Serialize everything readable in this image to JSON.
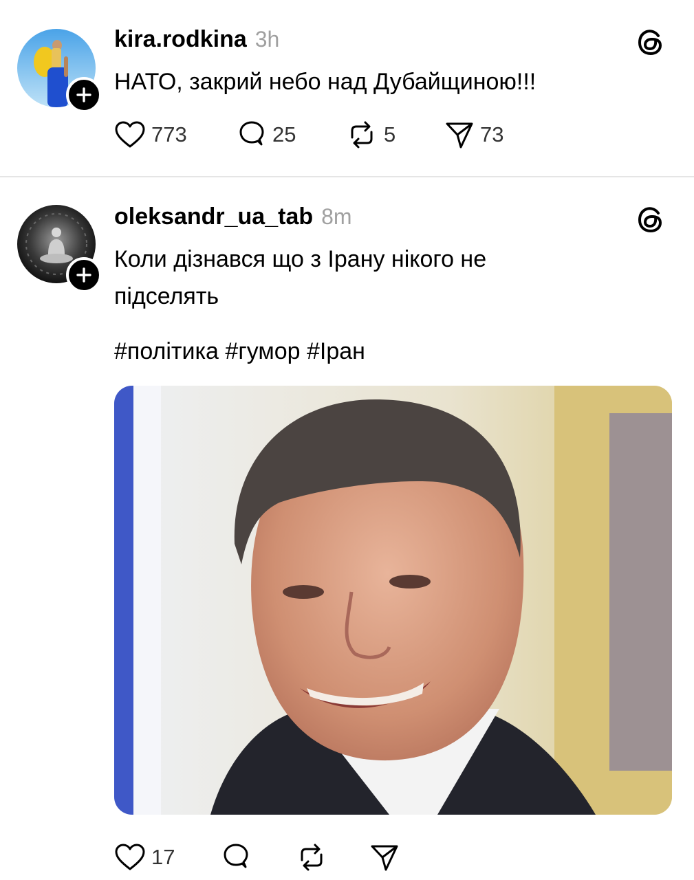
{
  "posts": [
    {
      "username": "kira.rodkina",
      "time": "3h",
      "text": "НАТО, закрий небо над Дубайщиною!!!",
      "avatar_icon": "avatar-photo-person-yellow-backpack",
      "stats": {
        "likes": "773",
        "replies": "25",
        "reposts": "5",
        "shares": "73"
      }
    },
    {
      "username": "oleksandr_ua_tab",
      "time": "8m",
      "text_line1": "Коли дізнався що з Ірану нікого не",
      "text_line2": "підселять",
      "hashtags": "#політика #гумор #Іран",
      "avatar_icon": "avatar-photo-meditating-figure",
      "media_icon": "photo-smiling-man-in-suit",
      "stats": {
        "likes": "17",
        "replies": "",
        "reposts": "",
        "shares": ""
      }
    }
  ],
  "icons": {
    "like": "heart-icon",
    "reply": "speech-bubble-icon",
    "repost": "repost-arrows-icon",
    "share": "paper-plane-icon",
    "brand": "threads-logo-icon",
    "follow": "plus-icon"
  },
  "colors": {
    "text": "#000000",
    "muted": "#a0a0a0",
    "action": "#333333",
    "divider": "#e5e5e5"
  }
}
